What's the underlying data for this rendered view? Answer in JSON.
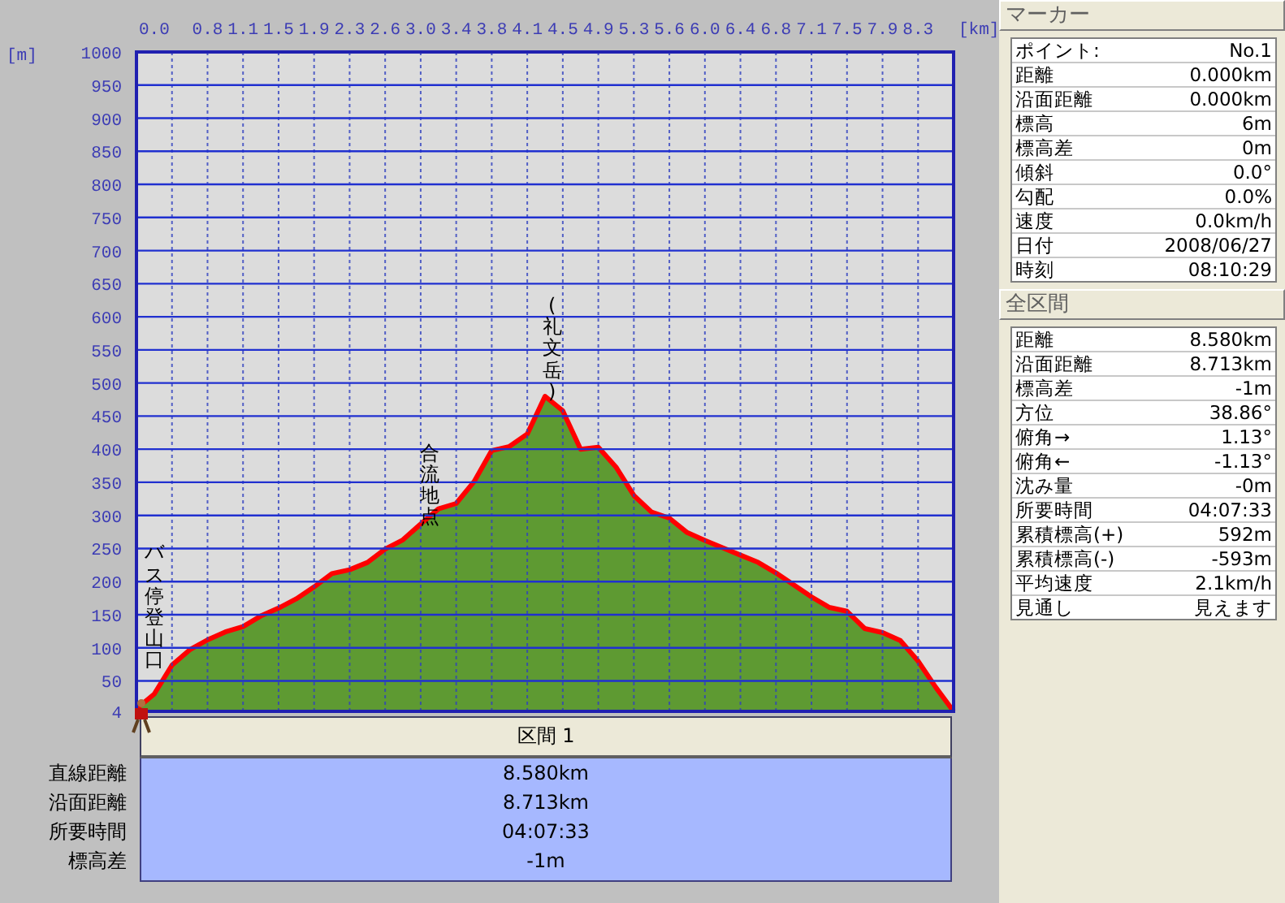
{
  "chart": {
    "chart_data": {
      "type": "area",
      "xlabel": "[km]",
      "ylabel": "[m]",
      "ylim": [
        4,
        1000
      ],
      "yticks": [
        4,
        50,
        100,
        150,
        200,
        250,
        300,
        350,
        400,
        450,
        500,
        550,
        600,
        650,
        700,
        750,
        800,
        850,
        900,
        950,
        1000
      ],
      "categories": [
        null,
        "0.0",
        null,
        null,
        "0.8",
        null,
        "1.1",
        null,
        "1.5",
        null,
        "1.9",
        null,
        "2.3",
        null,
        "2.6",
        null,
        "3.0",
        null,
        "3.4",
        null,
        "3.8",
        null,
        "4.1",
        null,
        "4.5",
        null,
        "4.9",
        null,
        "5.3",
        null,
        "5.6",
        null,
        "6.0",
        null,
        "6.4",
        null,
        "6.8",
        null,
        "7.1",
        null,
        "7.5",
        null,
        "7.9",
        null,
        "8.3",
        null,
        null
      ],
      "series": [
        {
          "color": "#5e9a32",
          "values": [
            8,
            30,
            74,
            97,
            112,
            124,
            132,
            148,
            160,
            174,
            192,
            212,
            218,
            229,
            249,
            263,
            287,
            310,
            318,
            351,
            398,
            404,
            423,
            480,
            458,
            400,
            403,
            373,
            330,
            305,
            296,
            274,
            262,
            251,
            240,
            229,
            213,
            195,
            177,
            161,
            155,
            129,
            123,
            111,
            80,
            40,
            4
          ]
        }
      ],
      "grid": true,
      "annotations": [
        "バス停登山口",
        "合流地点",
        "(礼文岳)"
      ]
    }
  },
  "section": {
    "title": "区間 1",
    "rows": [
      {
        "label": "直線距離",
        "value": "8.580km"
      },
      {
        "label": "沿面距離",
        "value": "8.713km"
      },
      {
        "label": "所要時間",
        "value": "04:07:33"
      },
      {
        "label": "標高差",
        "value": "-1m"
      }
    ]
  },
  "marker": {
    "title": "マーカー",
    "rows": [
      {
        "label": "ポイント:",
        "value": "No.1"
      },
      {
        "label": "距離",
        "value": "0.000km"
      },
      {
        "label": "沿面距離",
        "value": "0.000km"
      },
      {
        "label": "標高",
        "value": "6m"
      },
      {
        "label": "標高差",
        "value": "0m"
      },
      {
        "label": "傾斜",
        "value": "0.0°"
      },
      {
        "label": "勾配",
        "value": "0.0%"
      },
      {
        "label": "速度",
        "value": "0.0km/h"
      },
      {
        "label": "日付",
        "value": "2008/06/27"
      },
      {
        "label": "時刻",
        "value": "08:10:29"
      }
    ]
  },
  "total": {
    "title": "全区間",
    "rows": [
      {
        "label": "距離",
        "value": "8.580km"
      },
      {
        "label": "沿面距離",
        "value": "8.713km"
      },
      {
        "label": "標高差",
        "value": "-1m"
      },
      {
        "label": "方位",
        "value": "38.86°"
      },
      {
        "label": "俯角→",
        "value": "1.13°"
      },
      {
        "label": "俯角←",
        "value": "-1.13°"
      },
      {
        "label": "沈み量",
        "value": "-0m"
      },
      {
        "label": "所要時間",
        "value": "04:07:33"
      },
      {
        "label": "累積標高(+)",
        "value": "592m"
      },
      {
        "label": "累積標高(-)",
        "value": "-593m"
      },
      {
        "label": "平均速度",
        "value": "2.1km/h"
      },
      {
        "label": "見通し",
        "value": "見えます"
      }
    ]
  }
}
